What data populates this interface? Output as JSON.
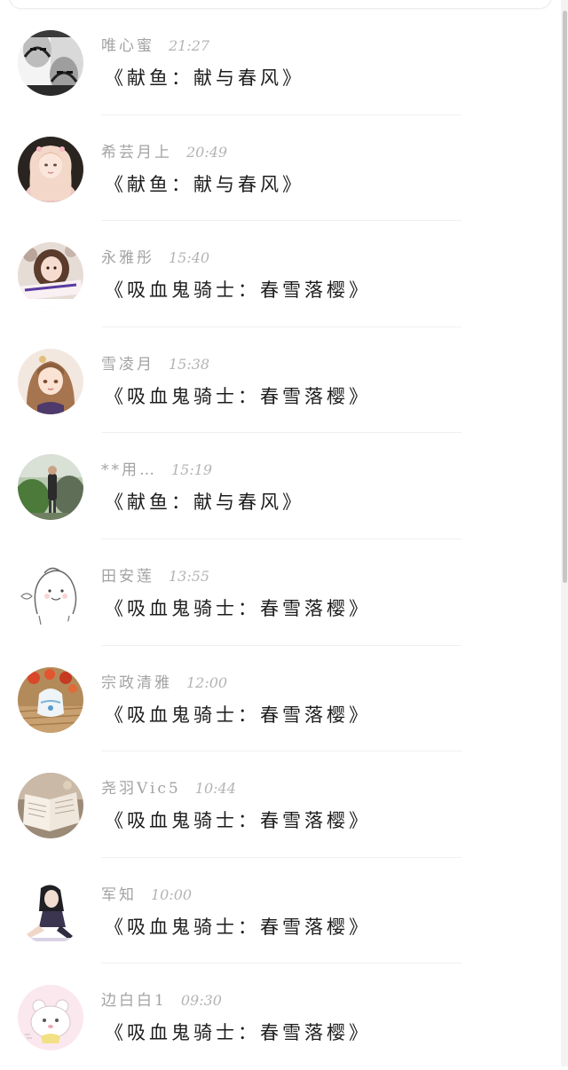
{
  "comments": [
    {
      "name": "唯心蜜",
      "time": "21:27",
      "message": "《献鱼：献与春风》",
      "avatar": "bw-face-collage"
    },
    {
      "name": "希芸月上",
      "time": "20:49",
      "message": "《献鱼：献与春风》",
      "avatar": "pink-anime-girl"
    },
    {
      "name": "永雅彤",
      "time": "15:40",
      "message": "《吸血鬼骑士：春雪落樱》",
      "avatar": "girl-with-sign"
    },
    {
      "name": "雪凌月",
      "time": "15:38",
      "message": "《吸血鬼骑士：春雪落樱》",
      "avatar": "brown-hair-anime-girl"
    },
    {
      "name": "**用…",
      "time": "15:19",
      "message": "《献鱼：献与春风》",
      "avatar": "person-in-garden"
    },
    {
      "name": "田安莲",
      "time": "13:55",
      "message": "《吸血鬼骑士：春雪落樱》",
      "avatar": "line-doodle"
    },
    {
      "name": "宗政清雅",
      "time": "12:00",
      "message": "《吸血鬼骑士：春雪落樱》",
      "avatar": "wind-chime-flowers"
    },
    {
      "name": "尧羽Vic5",
      "time": "10:44",
      "message": "《吸血鬼骑士：春雪落樱》",
      "avatar": "open-book"
    },
    {
      "name": "军知",
      "time": "10:00",
      "message": "《吸血鬼骑士：春雪落樱》",
      "avatar": "sitting-anime-figure"
    },
    {
      "name": "边白白1",
      "time": "09:30",
      "message": "《吸血鬼骑士：春雪落樱》",
      "avatar": "pink-bear-cartoon"
    }
  ]
}
